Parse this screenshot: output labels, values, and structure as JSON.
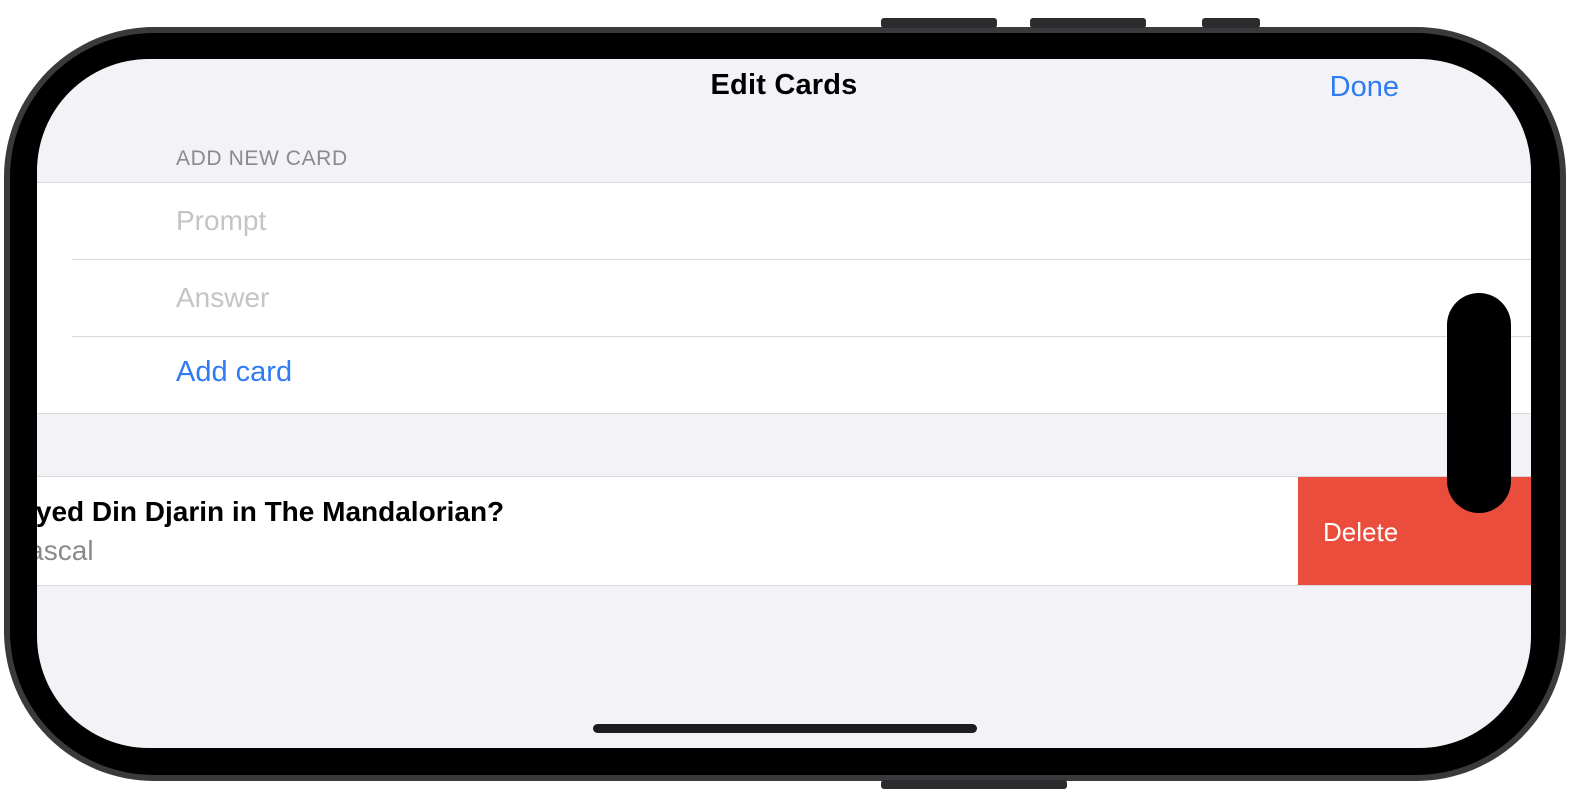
{
  "nav": {
    "title": "Edit Cards",
    "done_label": "Done"
  },
  "add_section": {
    "header": "ADD NEW CARD",
    "prompt_placeholder": "Prompt",
    "answer_placeholder": "Answer",
    "add_label": "Add card"
  },
  "cards": [
    {
      "prompt": "Who played Din Djarin in The Mandalorian?",
      "answer": "Pedro Pascal",
      "delete_label": "Delete"
    }
  ],
  "colors": {
    "accent": "#2f7bf6",
    "destructive": "#eb4d3d",
    "grouped_background": "#f2f2f7"
  }
}
